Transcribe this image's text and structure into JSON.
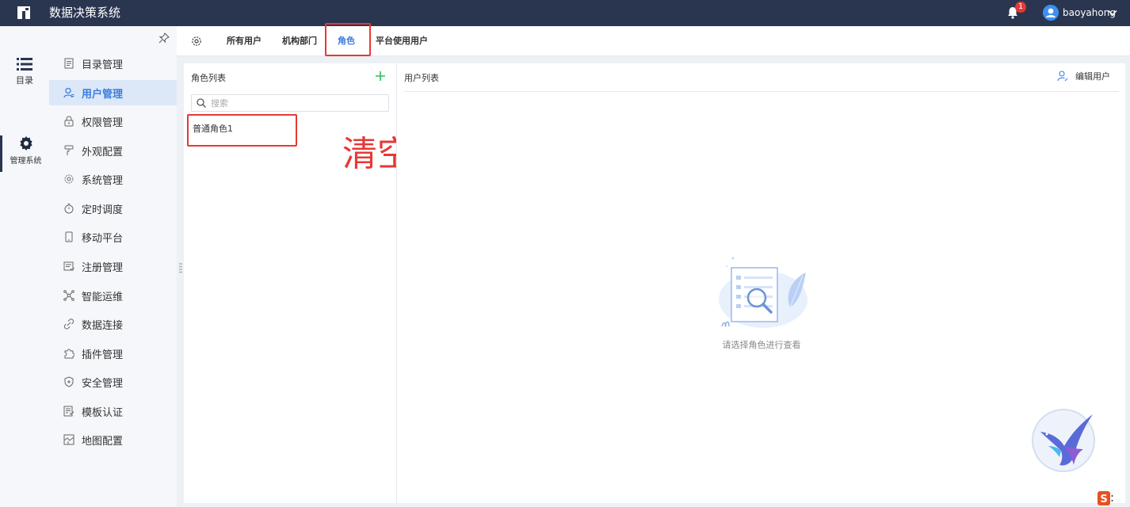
{
  "topbar": {
    "app_title": "数据决策系统",
    "notification_count": "1",
    "username": "baoyahong"
  },
  "rail": {
    "items": [
      {
        "label": "目录"
      },
      {
        "label": "管理系统"
      }
    ]
  },
  "submenu": {
    "items": [
      {
        "label": "目录管理"
      },
      {
        "label": "用户管理"
      },
      {
        "label": "权限管理"
      },
      {
        "label": "外观配置"
      },
      {
        "label": "系统管理"
      },
      {
        "label": "定时调度"
      },
      {
        "label": "移动平台"
      },
      {
        "label": "注册管理"
      },
      {
        "label": "智能运维"
      },
      {
        "label": "数据连接"
      },
      {
        "label": "插件管理"
      },
      {
        "label": "安全管理"
      },
      {
        "label": "模板认证"
      },
      {
        "label": "地图配置"
      }
    ]
  },
  "tabs": [
    {
      "label": "所有用户"
    },
    {
      "label": "机构部门"
    },
    {
      "label": "角色"
    },
    {
      "label": "平台使用用户"
    }
  ],
  "role_panel": {
    "title": "角色列表",
    "search_placeholder": "搜索",
    "roles": [
      {
        "label": "普通角色1"
      }
    ]
  },
  "annotation": "清空",
  "user_panel": {
    "title": "用户列表",
    "edit_label": "编辑用户",
    "empty_text": "请选择角色进行查看"
  },
  "colors": {
    "topbar": "#2a3550",
    "accent": "#3a7de0",
    "annotation_red": "#e53935",
    "add_green": "#2ebd59"
  }
}
